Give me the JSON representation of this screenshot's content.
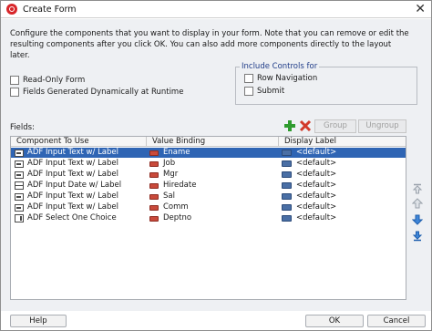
{
  "window": {
    "title": "Create Form"
  },
  "description": "Configure the components that you want to display in your form. Note that you can remove or edit the resulting components after you click OK. You can also add more components directly to the layout later.",
  "options": {
    "read_only_label": "Read-Only Form",
    "dynamic_label": "Fields Generated Dynamically at Runtime"
  },
  "include_controls": {
    "legend": "Include Controls for",
    "row_navigation": "Row Navigation",
    "submit": "Submit"
  },
  "fields": {
    "label": "Fields:",
    "group_label": "Group",
    "ungroup_label": "Ungroup",
    "columns": [
      "Component To Use",
      "Value Binding",
      "Display Label"
    ],
    "rows": [
      {
        "component": "ADF Input Text w/ Label",
        "binding": "Ename",
        "display": "<default>",
        "icon": "input-text-icon",
        "selected": true
      },
      {
        "component": "ADF Input Text w/ Label",
        "binding": "Job",
        "display": "<default>",
        "icon": "input-text-icon",
        "selected": false
      },
      {
        "component": "ADF Input Text w/ Label",
        "binding": "Mgr",
        "display": "<default>",
        "icon": "input-text-icon",
        "selected": false
      },
      {
        "component": "ADF Input Date w/ Label",
        "binding": "Hiredate",
        "display": "<default>",
        "icon": "input-date-icon",
        "selected": false
      },
      {
        "component": "ADF Input Text w/ Label",
        "binding": "Sal",
        "display": "<default>",
        "icon": "input-text-icon",
        "selected": false
      },
      {
        "component": "ADF Input Text w/ Label",
        "binding": "Comm",
        "display": "<default>",
        "icon": "input-text-icon",
        "selected": false
      },
      {
        "component": "ADF Select One Choice",
        "binding": "Deptno",
        "display": "<default>",
        "icon": "select-choice-icon",
        "selected": false
      }
    ]
  },
  "footer": {
    "help": "Help",
    "ok": "OK",
    "cancel": "Cancel"
  },
  "colors": {
    "selection": "#2f65b4",
    "accent_text": "#1f3c88",
    "add_icon": "#2e9b2e",
    "delete_icon": "#d23a2a"
  }
}
